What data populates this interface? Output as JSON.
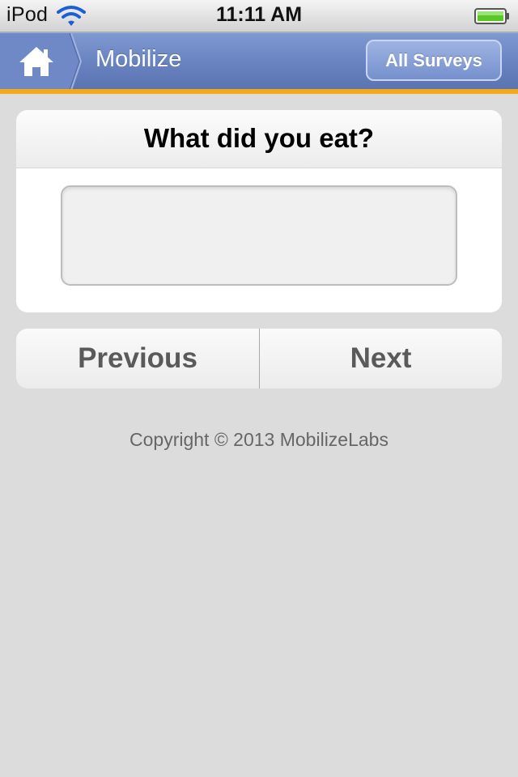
{
  "status_bar": {
    "carrier": "iPod",
    "time": "11:11 AM",
    "wifi_icon": "wifi-icon",
    "battery_icon": "battery-icon"
  },
  "header": {
    "home_icon": "home-icon",
    "title": "Mobilize",
    "all_surveys_label": "All Surveys"
  },
  "question": {
    "title": "What did you eat?",
    "answer_value": "",
    "answer_placeholder": ""
  },
  "navigation": {
    "previous_label": "Previous",
    "next_label": "Next"
  },
  "footer": {
    "copyright": "Copyright © 2013 MobilizeLabs"
  },
  "colors": {
    "header_blue": "#6984c0",
    "accent_orange": "#f4a91a",
    "background": "#dcdcdc",
    "battery_green": "#5ac628"
  }
}
